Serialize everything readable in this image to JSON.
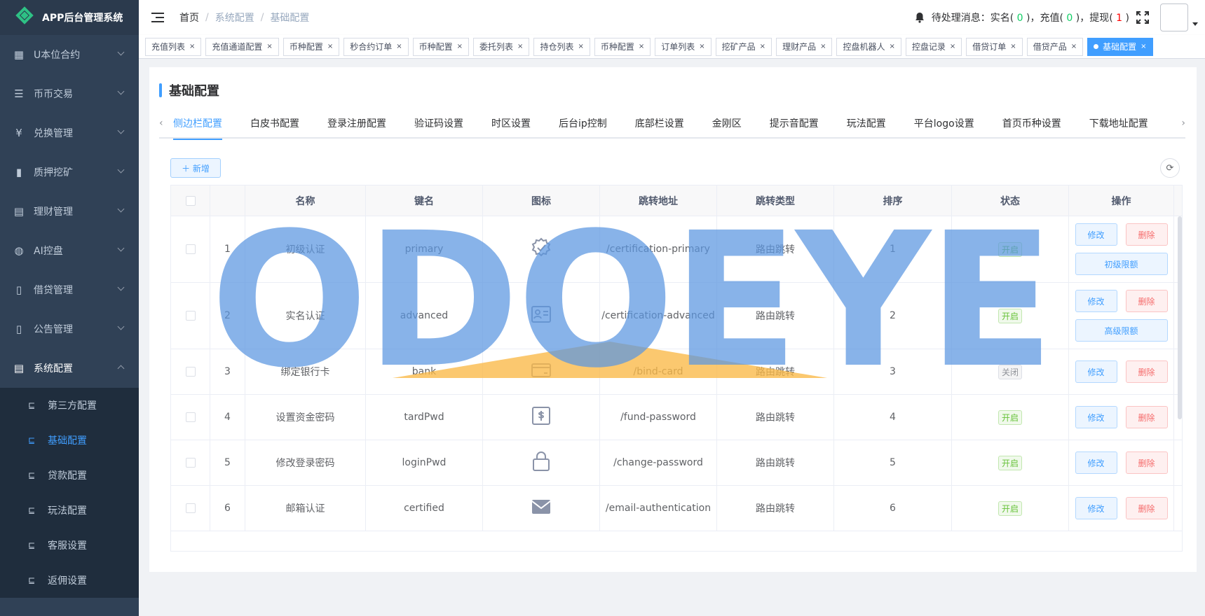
{
  "app": {
    "title": "APP后台管理系统"
  },
  "sidebar": {
    "items": [
      {
        "icon": "table-icon",
        "glyph": "▦",
        "label": "U本位合约"
      },
      {
        "icon": "list-icon",
        "glyph": "☰",
        "label": "币币交易"
      },
      {
        "icon": "yen-icon",
        "glyph": "¥",
        "label": "兑换管理"
      },
      {
        "icon": "chart-icon",
        "glyph": "▮",
        "label": "质押挖矿"
      },
      {
        "icon": "document-icon",
        "glyph": "▤",
        "label": "理财管理"
      },
      {
        "icon": "robot-icon",
        "glyph": "◍",
        "label": "AI控盘"
      },
      {
        "icon": "book-icon",
        "glyph": "▯",
        "label": "借贷管理"
      },
      {
        "icon": "notice-book-icon",
        "glyph": "▯",
        "label": "公告管理"
      },
      {
        "icon": "config-icon",
        "glyph": "▤",
        "label": "系统配置"
      }
    ],
    "submenu": [
      {
        "label": "第三方配置"
      },
      {
        "label": "基础配置"
      },
      {
        "label": "贷款配置"
      },
      {
        "label": "玩法配置"
      },
      {
        "label": "客服设置"
      },
      {
        "label": "返佣设置"
      }
    ]
  },
  "header": {
    "breadcrumb": [
      "首页",
      "系统配置",
      "基础配置"
    ],
    "notice_prefix": "待处理消息：实名(",
    "realname_count": " 0 ",
    "notice_mid1": ")，充值(",
    "recharge_count": " 0 ",
    "notice_mid2": ")，提现(",
    "withdraw_count": " 1 ",
    "notice_suffix": ")"
  },
  "tags": [
    "充值列表",
    "充值通道配置",
    "币种配置",
    "秒合约订单",
    "币种配置",
    "委托列表",
    "持仓列表",
    "币种配置",
    "订单列表",
    "挖矿产品",
    "理财产品",
    "控盘机器人",
    "控盘记录",
    "借贷订单",
    "借贷产品",
    "基础配置"
  ],
  "page": {
    "title": "基础配置",
    "tabs": [
      "侧边栏配置",
      "白皮书配置",
      "登录注册配置",
      "验证码设置",
      "时区设置",
      "后台ip控制",
      "底部栏设置",
      "金刚区",
      "提示音配置",
      "玩法配置",
      "平台logo设置",
      "首页币种设置",
      "下载地址配置"
    ],
    "add_label": "＋ 新增"
  },
  "table": {
    "headers": [
      "名称",
      "键名",
      "图标",
      "跳转地址",
      "跳转类型",
      "排序",
      "状态",
      "操作"
    ],
    "edit_label": "修改",
    "delete_label": "删除",
    "rows": [
      {
        "idx": "1",
        "name": "初级认证",
        "key": "primary",
        "icon": "verified-badge-icon",
        "url": "/certification-primary",
        "type": "路由跳转",
        "sort": "1",
        "status": "开启",
        "on": true,
        "limit": "初级限额"
      },
      {
        "idx": "2",
        "name": "实名认证",
        "key": "advanced",
        "icon": "id-card-icon",
        "url": "/certification-advanced",
        "type": "路由跳转",
        "sort": "2",
        "status": "开启",
        "on": true,
        "limit": "高级限额"
      },
      {
        "idx": "3",
        "name": "绑定银行卡",
        "key": "bank",
        "icon": "bank-card-icon",
        "url": "/bind-card",
        "type": "路由跳转",
        "sort": "3",
        "status": "关闭",
        "on": false,
        "limit": ""
      },
      {
        "idx": "4",
        "name": "设置资金密码",
        "key": "tardPwd",
        "icon": "fund-transfer-icon",
        "url": "/fund-password",
        "type": "路由跳转",
        "sort": "4",
        "status": "开启",
        "on": true,
        "limit": ""
      },
      {
        "idx": "5",
        "name": "修改登录密码",
        "key": "loginPwd",
        "icon": "lock-icon",
        "url": "/change-password",
        "type": "路由跳转",
        "sort": "5",
        "status": "开启",
        "on": true,
        "limit": ""
      },
      {
        "idx": "6",
        "name": "邮箱认证",
        "key": "certified",
        "icon": "mail-icon",
        "url": "/email-authentication",
        "type": "路由跳转",
        "sort": "6",
        "status": "开启",
        "on": true,
        "limit": ""
      }
    ]
  },
  "watermark": {
    "text": "ODOEYE"
  },
  "colors": {
    "sidebar_bg": "#304156",
    "accent": "#409eff",
    "success": "#67c23a",
    "danger": "#f56c6c"
  }
}
